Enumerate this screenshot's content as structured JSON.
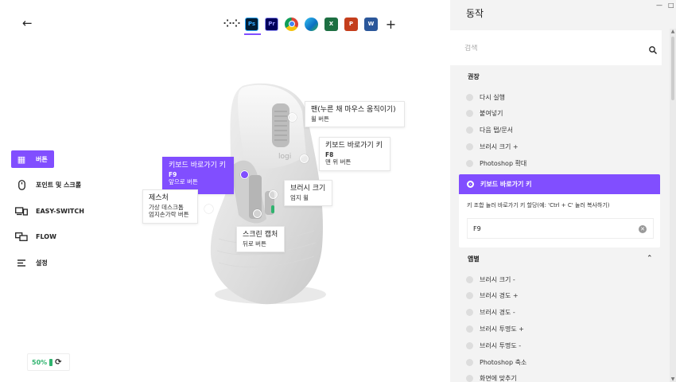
{
  "toolbar": {
    "back_icon": "arrow-left-icon",
    "apps": [
      {
        "name": "all-apps",
        "label": "⁘⁘"
      },
      {
        "name": "photoshop",
        "label": "Ps"
      },
      {
        "name": "premiere",
        "label": "Pr"
      },
      {
        "name": "chrome",
        "label": ""
      },
      {
        "name": "edge",
        "label": ""
      },
      {
        "name": "excel",
        "label": "X"
      },
      {
        "name": "powerpoint",
        "label": "P"
      },
      {
        "name": "word",
        "label": "W"
      },
      {
        "name": "add",
        "label": "+"
      }
    ]
  },
  "nav": {
    "items": [
      {
        "label": "버튼",
        "icon": "buttons-icon"
      },
      {
        "label": "포인트 및 스크롤",
        "icon": "mouse-icon"
      },
      {
        "label": "EASY-SWITCH",
        "icon": "easy-switch-icon"
      },
      {
        "label": "FLOW",
        "icon": "flow-icon"
      },
      {
        "label": "설정",
        "icon": "settings-icon"
      }
    ]
  },
  "battery": {
    "percent": "50%"
  },
  "callouts": {
    "wheel": {
      "title": "팬(누른 채 마우스 움직이기)",
      "sub": "휠 버튼"
    },
    "top": {
      "title": "키보드 바로가기 키",
      "key": "F8",
      "sub": "맨 위 버튼"
    },
    "forward": {
      "title": "키보드 바로가기 키",
      "key": "F9",
      "sub": "앞으로 버튼"
    },
    "thumbwheel": {
      "title": "브러시 크기",
      "sub": "엄지 휠"
    },
    "gesture": {
      "title": "제스처",
      "sub1": "가상 데스크톱",
      "sub2": "엄지손가락 버튼"
    },
    "back": {
      "title": "스크린 캡처",
      "sub": "뒤로 버튼"
    }
  },
  "panel": {
    "title": "동작",
    "search_placeholder": "검색",
    "recommended_header": "권장",
    "recommended": [
      "다시 실행",
      "붙여넣기",
      "다음 탭/문서",
      "브러시 크기 +",
      "Photoshop 확대"
    ],
    "selected": {
      "label": "키보드 바로가기 키",
      "description": "키 조합 눌러 바로가기 키 할당(예: 'Ctrl + C' 눌러 복사하기)",
      "value": "F9"
    },
    "app_header": "앱별",
    "app_items": [
      "브러시 크기 -",
      "브러시 경도 +",
      "브러시 경도 -",
      "브러시 투명도 +",
      "브러시 투명도 -",
      "Photoshop 축소",
      "화면에 맞추기"
    ]
  },
  "colors": {
    "accent": "#814eff",
    "battery": "#2fb36e"
  }
}
